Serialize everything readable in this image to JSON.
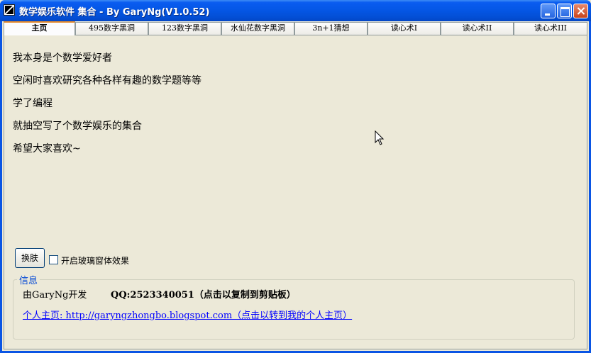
{
  "window": {
    "title": "数学娱乐软件 集合 - By GaryNg(V1.0.52)"
  },
  "tabs": [
    {
      "label": "主页",
      "active": true
    },
    {
      "label": "495数字黑洞",
      "active": false
    },
    {
      "label": "123数字黑洞",
      "active": false
    },
    {
      "label": "水仙花数字黑洞",
      "active": false
    },
    {
      "label": "3n+1猜想",
      "active": false
    },
    {
      "label": "读心术I",
      "active": false
    },
    {
      "label": "读心术II",
      "active": false
    },
    {
      "label": "读心术III",
      "active": false
    }
  ],
  "main": {
    "lines": [
      "我本身是个数学爱好者",
      "空闲时喜欢研究各种各样有趣的数学题等等",
      "学了编程",
      "就抽空写了个数学娱乐的集合",
      "希望大家喜欢~"
    ],
    "skin_button": "换肤",
    "glass_effect_label": "开启玻璃窗体效果",
    "glass_effect_checked": false
  },
  "info": {
    "group_title": "信息",
    "developer": "由GaryNg开发",
    "qq": "QQ:2523340051（点击以复制到剪贴板）",
    "homepage": "个人主页: http://garyngzhongbo.blogspot.com（点击以转到我的个人主页）"
  },
  "colors": {
    "titlebar": "#0557e6",
    "active_tab_accent": "#e68b2c",
    "link": "#0000ff",
    "group_title": "#0046d5"
  }
}
